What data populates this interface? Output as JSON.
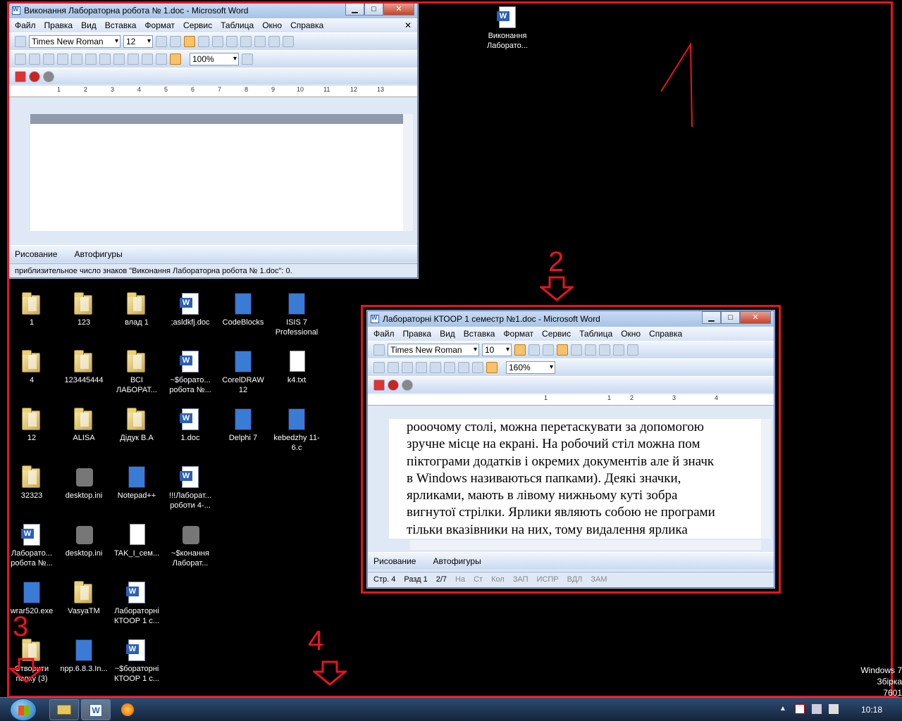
{
  "win1": {
    "title": "Виконання Лабораторна робота № 1.doc - Microsoft Word",
    "menu": [
      "Файл",
      "Правка",
      "Вид",
      "Вставка",
      "Формат",
      "Сервис",
      "Таблица",
      "Окно",
      "Справка"
    ],
    "font": "Times New Roman",
    "size": "12",
    "zoom": "100%",
    "ruler": [
      "1",
      "2",
      "3",
      "4",
      "5",
      "6",
      "7",
      "8",
      "9",
      "10",
      "11",
      "12",
      "13"
    ],
    "draw_label": "Рисование",
    "autoshapes": "Автофигуры",
    "status": "приблизительное число знаков \"Виконання Лабораторна робота № 1.doc\": 0."
  },
  "win2": {
    "title": "Лабораторні КТООР 1 семестр №1.doc - Microsoft Word",
    "menu": [
      "Файл",
      "Правка",
      "Вид",
      "Вставка",
      "Формат",
      "Сервис",
      "Таблица",
      "Окно",
      "Справка"
    ],
    "font": "Times New Roman",
    "size": "10",
    "zoom": "160%",
    "ruler": [
      "1",
      "1",
      "2",
      "3",
      "4"
    ],
    "text": [
      "рооочому столі, можна перетаскувати за допомогою",
      "зручне місце на екрані. На робочий стіл можна пом",
      "піктограми додатків і окремих документів але й значк",
      "в Windows називаються папками). Деякі значки,",
      "ярликами, мають в лівому нижньому куті зобра",
      "вигнутої стрілки. Ярлики являють собою не програми",
      "тільки вказівники на них, тому видалення ярлика"
    ],
    "draw_label": "Рисование",
    "autoshapes": "Автофигуры",
    "status": {
      "page": "Стр.",
      "page_v": "4",
      "sec": "Разд",
      "sec_v": "1",
      "of": "2/7",
      "at": "На",
      "ln": "Ст",
      "col": "Кол",
      "rec": "ЗАП",
      "trk": "ИСПР",
      "ext": "ВДЛ",
      "ovr": "ЗАМ"
    }
  },
  "desktop_file": "Виконання Лаборато...",
  "icons": [
    {
      "label": "1",
      "type": "folder"
    },
    {
      "label": "123",
      "type": "folder"
    },
    {
      "label": "влад 1",
      "type": "folder"
    },
    {
      "label": ";asldkfj.doc",
      "type": "doc"
    },
    {
      "label": "CodeBlocks",
      "type": "app"
    },
    {
      "label": "ISIS 7 Professional",
      "type": "app"
    },
    {
      "label": "4",
      "type": "folder"
    },
    {
      "label": "123445444",
      "type": "folder"
    },
    {
      "label": "ВСІ ЛАБОРАТ...",
      "type": "folder"
    },
    {
      "label": "~$борато... робота №...",
      "type": "doc"
    },
    {
      "label": "CorelDRAW 12",
      "type": "app"
    },
    {
      "label": "k4.txt",
      "type": "txt"
    },
    {
      "label": "12",
      "type": "folder"
    },
    {
      "label": "ALISA",
      "type": "folder"
    },
    {
      "label": "Дідук В.А",
      "type": "folder"
    },
    {
      "label": "1.doc",
      "type": "doc"
    },
    {
      "label": "Delphi 7",
      "type": "app"
    },
    {
      "label": "kebedzhy 11-6.c",
      "type": "app"
    },
    {
      "label": "32323",
      "type": "folder"
    },
    {
      "label": "desktop.ini",
      "type": "gear"
    },
    {
      "label": "Notepad++",
      "type": "app"
    },
    {
      "label": "!!!Лаборат... роботи 4-...",
      "type": "doc"
    },
    {
      "label": "Лаборато... робота №...",
      "type": "doc"
    },
    {
      "label": "desktop.ini",
      "type": "gear"
    },
    {
      "label": "TAK_I_сем...",
      "type": "txt"
    },
    {
      "label": "~$конання Лаборат...",
      "type": "gear"
    },
    {
      "label": "wrar520.exe",
      "type": "app"
    },
    {
      "label": "VasyaTM",
      "type": "folder"
    },
    {
      "label": "Лабораторні КТООР 1 с...",
      "type": "doc"
    },
    {
      "label": "Створити папку (3)",
      "type": "folder"
    },
    {
      "label": "npp.6.8.3.In...",
      "type": "app"
    },
    {
      "label": "~$бораторні КТООР 1 с...",
      "type": "doc"
    }
  ],
  "annotations": {
    "n1": "1",
    "n2": "2",
    "n3": "3",
    "n4": "4"
  },
  "taskbar": {
    "clock": "10:18"
  },
  "watermark": {
    "l1": "Windows 7",
    "l2": "Збірка 7601"
  },
  "colors": {
    "annotation": "#e8141f",
    "desktop": "#000000",
    "taskbar": "#1c3050"
  }
}
